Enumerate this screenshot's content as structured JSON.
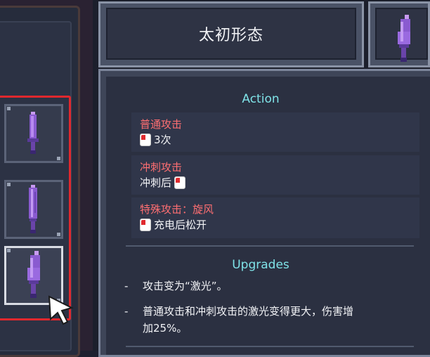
{
  "weapon": {
    "title": "太初形态"
  },
  "action": {
    "heading": "Action",
    "attacks": [
      {
        "name": "普通攻击",
        "input_icon": "mouse-button-icon",
        "desc": "3次"
      },
      {
        "name": "冲刺攻击",
        "input_icon": "mouse-button-icon",
        "desc": "冲刺后"
      },
      {
        "name": "特殊攻击：旋风",
        "input_icon": "mouse-button-icon",
        "desc": "充电后松开"
      }
    ]
  },
  "upgrades": {
    "heading": "Upgrades",
    "items": [
      {
        "bullet": "-",
        "text": "攻击变为“激光”。"
      },
      {
        "bullet": "-",
        "text_line1": "普通攻击和冲刺攻击的激光变得更大，伤害增",
        "text_line2": "加25%。"
      }
    ]
  },
  "inventory": {
    "slots": [
      {
        "icon": "purple-sword-icon",
        "state": "normal"
      },
      {
        "icon": "purple-sword-icon",
        "state": "normal"
      },
      {
        "icon": "purple-sword-icon",
        "state": "selected"
      }
    ]
  },
  "colors": {
    "accent_cyan": "#7fe3e8",
    "attack_red": "#ff6f72",
    "selection_red": "#e0282e",
    "weapon_purple": "#9b6bd8"
  }
}
